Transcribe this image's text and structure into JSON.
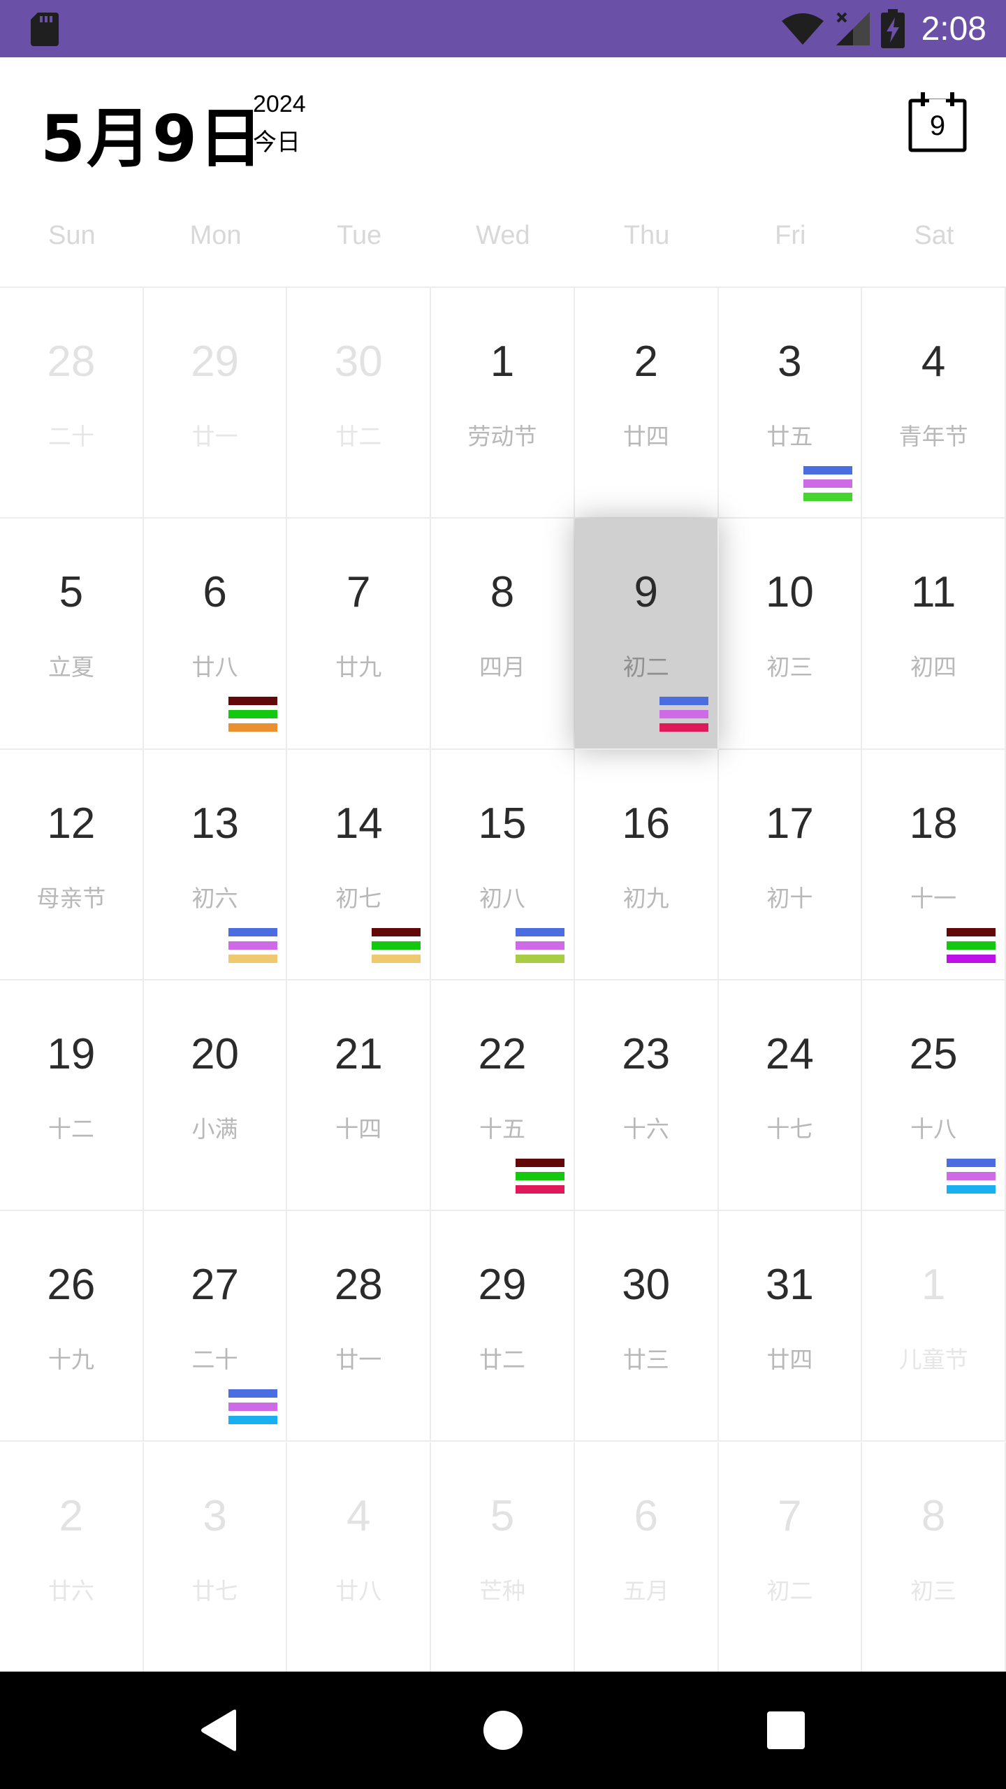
{
  "status_bar": {
    "time": "2:08",
    "icons": [
      "sd-card-icon",
      "wifi-icon",
      "cell-signal-icon",
      "battery-charging-icon"
    ],
    "background_color": "#6a50a7"
  },
  "header": {
    "date": "5月9日",
    "year": "2024",
    "today_label": "今日",
    "today_button_day": "9"
  },
  "weekdays": [
    "Sun",
    "Mon",
    "Tue",
    "Wed",
    "Thu",
    "Fri",
    "Sat"
  ],
  "weeks": [
    [
      {
        "day": "28",
        "sub": "二十",
        "other": true
      },
      {
        "day": "29",
        "sub": "廿一",
        "other": true
      },
      {
        "day": "30",
        "sub": "廿二",
        "other": true
      },
      {
        "day": "1",
        "sub": "劳动节"
      },
      {
        "day": "2",
        "sub": "廿四"
      },
      {
        "day": "3",
        "sub": "廿五",
        "bars": [
          "#4a6ee0",
          "#cf6ae6",
          "#46d42e"
        ]
      },
      {
        "day": "4",
        "sub": "青年节"
      }
    ],
    [
      {
        "day": "5",
        "sub": "立夏"
      },
      {
        "day": "6",
        "sub": "廿八",
        "bars": [
          "#620808",
          "#14c810",
          "#ea9030"
        ]
      },
      {
        "day": "7",
        "sub": "廿九"
      },
      {
        "day": "8",
        "sub": "四月"
      },
      {
        "day": "9",
        "sub": "初二",
        "selected": true,
        "bars": [
          "#4a6ee0",
          "#cf6ae6",
          "#e01a5a"
        ]
      },
      {
        "day": "10",
        "sub": "初三"
      },
      {
        "day": "11",
        "sub": "初四"
      }
    ],
    [
      {
        "day": "12",
        "sub": "母亲节"
      },
      {
        "day": "13",
        "sub": "初六",
        "bars": [
          "#4a6ee0",
          "#cf6ae6",
          "#f0c870"
        ]
      },
      {
        "day": "14",
        "sub": "初七",
        "bars": [
          "#620808",
          "#14c810",
          "#f0c870"
        ]
      },
      {
        "day": "15",
        "sub": "初八",
        "bars": [
          "#4a6ee0",
          "#cf6ae6",
          "#a8cc44"
        ]
      },
      {
        "day": "16",
        "sub": "初九"
      },
      {
        "day": "17",
        "sub": "初十"
      },
      {
        "day": "18",
        "sub": "十一",
        "bars": [
          "#620808",
          "#14c810",
          "#c010e8"
        ]
      }
    ],
    [
      {
        "day": "19",
        "sub": "十二"
      },
      {
        "day": "20",
        "sub": "小满"
      },
      {
        "day": "21",
        "sub": "十四"
      },
      {
        "day": "22",
        "sub": "十五",
        "bars": [
          "#620808",
          "#14c810",
          "#e01a5a"
        ]
      },
      {
        "day": "23",
        "sub": "十六"
      },
      {
        "day": "24",
        "sub": "十七"
      },
      {
        "day": "25",
        "sub": "十八",
        "bars": [
          "#4a6ee0",
          "#cf6ae6",
          "#18b0f0"
        ]
      }
    ],
    [
      {
        "day": "26",
        "sub": "十九"
      },
      {
        "day": "27",
        "sub": "二十",
        "bars": [
          "#4a6ee0",
          "#cf6ae6",
          "#18b0f0"
        ]
      },
      {
        "day": "28",
        "sub": "廿一"
      },
      {
        "day": "29",
        "sub": "廿二"
      },
      {
        "day": "30",
        "sub": "廿三"
      },
      {
        "day": "31",
        "sub": "廿四"
      },
      {
        "day": "1",
        "sub": "儿童节",
        "other": true
      }
    ],
    [
      {
        "day": "2",
        "sub": "廿六",
        "other": true
      },
      {
        "day": "3",
        "sub": "廿七",
        "other": true
      },
      {
        "day": "4",
        "sub": "廿八",
        "other": true
      },
      {
        "day": "5",
        "sub": "芒种",
        "other": true
      },
      {
        "day": "6",
        "sub": "五月",
        "other": true
      },
      {
        "day": "7",
        "sub": "初二",
        "other": true
      },
      {
        "day": "8",
        "sub": "初三",
        "other": true
      }
    ]
  ],
  "nav_bar": {
    "buttons": [
      "back-icon",
      "home-icon",
      "recents-icon"
    ]
  }
}
